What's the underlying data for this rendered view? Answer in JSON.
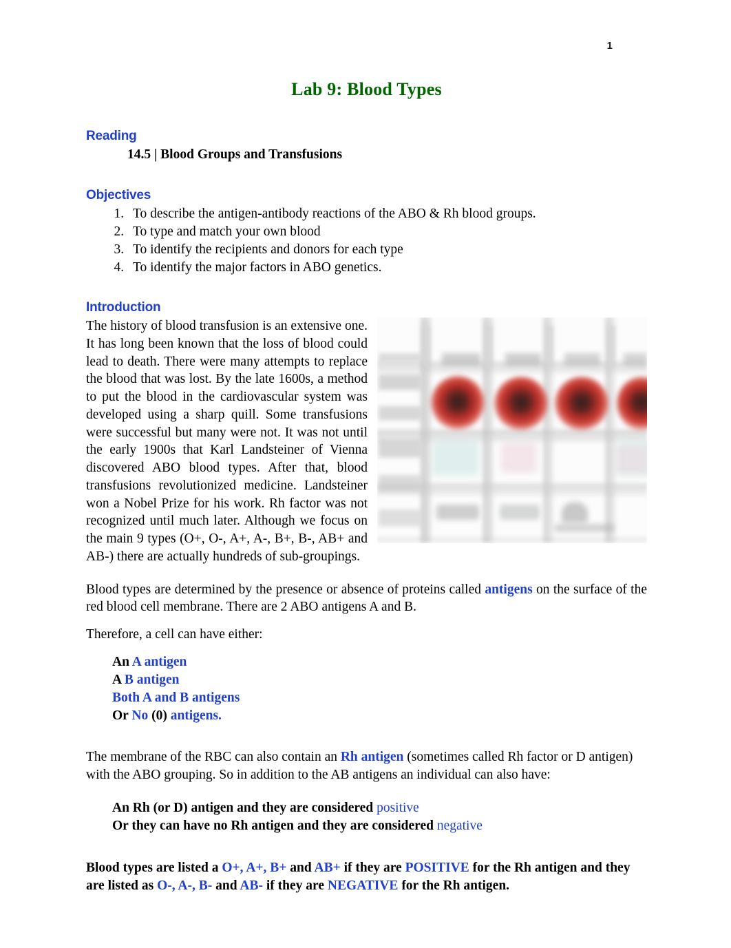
{
  "page": {
    "number": "1"
  },
  "title": "Lab 9:  Blood Types",
  "sections": {
    "reading": {
      "heading": "Reading",
      "item": "14.5 | Blood Groups and Transfusions"
    },
    "objectives": {
      "heading": "Objectives",
      "items": [
        "To describe the antigen-antibody reactions of the ABO & Rh blood groups.",
        "To type and match your own blood",
        "To identify the recipients and donors for each type",
        "To identify the major factors in ABO genetics."
      ]
    },
    "introduction": {
      "heading": "Introduction",
      "paragraph1": "The history of blood transfusion is an extensive one. It has long been known that the loss of blood could lead to death. There were many attempts to replace the blood that was lost.  By the late 1600s, a method to put the blood in the cardiovascular system was developed using a sharp quill. Some transfusions were successful but many were not. It was not until the early 1900s that Karl Landsteiner of Vienna discovered ABO blood types. After that, blood transfusions revolutionized medicine. Landsteiner won a Nobel Prize for his work. Rh factor was not recognized until much later.  Although we focus on the main 9 types (O+, O-, A+, A-, B+, B-, AB+ and AB-) there are actually hundreds of sub-groupings.",
      "paragraph2_part1": "Blood types are determined by the presence or absence of proteins called ",
      "paragraph2_antigens": "antigens",
      "paragraph2_part2": " on the surface of the red blood cell membrane. There are 2 ABO antigens A and B.",
      "paragraph3": "Therefore, a cell can have either:",
      "antigen_options": [
        {
          "prefix": "An ",
          "blue": "A antigen",
          "suffix": ""
        },
        {
          "prefix": "A ",
          "blue": "B antigen",
          "suffix": ""
        },
        {
          "prefix": "",
          "blue": "Both A and B antigens",
          "suffix": ""
        },
        {
          "prefix": "Or ",
          "blue": "No",
          "mid": " (0) ",
          "blue2": "antigens.",
          "suffix": ""
        }
      ],
      "rh_paragraph_part1": "The membrane of the RBC can also contain an ",
      "rh_paragraph_highlight": "Rh antigen",
      "rh_paragraph_part2": " (sometimes called Rh factor or D antigen) with the ABO grouping.  So in addition to the AB antigens an individual can also have:",
      "rh_options": [
        {
          "text": "An Rh (or D) antigen and they are considered ",
          "blue": "positive"
        },
        {
          "text": "Or they can have no Rh antigen and they are considered ",
          "blue": "negative"
        }
      ],
      "final_note": {
        "t1": "Blood types are listed a ",
        "b1": "O+, A+, B+",
        "t2": " and ",
        "b2": "AB+",
        "t3": " if they are ",
        "b3": "POSITIVE",
        "t4": " for the Rh antigen and they are listed as ",
        "b4": "O-, A-, B-",
        "t5": " and ",
        "b5": "AB-",
        "t6": " if they are ",
        "b6": "NEGATIVE",
        "t7": " for the Rh antigen."
      }
    }
  },
  "figure": {
    "name": "blood-typing-tray-photo",
    "description": "Blurred photograph of a blood typing tray with four dark red blood drops in a row of wells"
  },
  "colors": {
    "title_green": "#006400",
    "heading_blue": "#1f3fcc",
    "accent_blue": "#1f3fcc",
    "body_black": "#000000",
    "blood_red": "#b33028",
    "blood_dark": "#3a1f1d"
  }
}
